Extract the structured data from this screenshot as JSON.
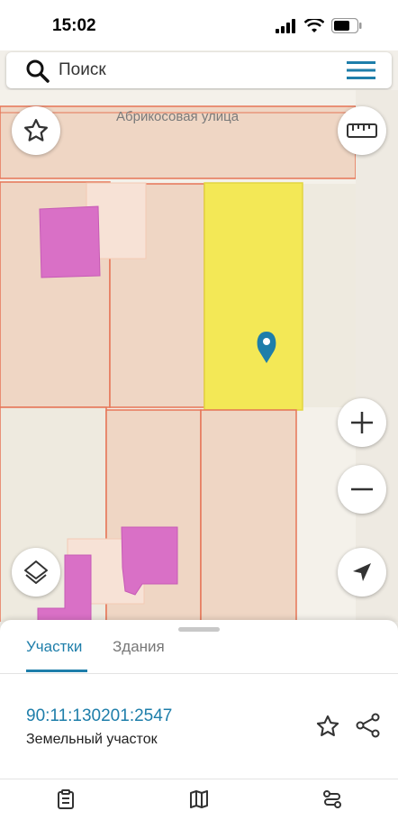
{
  "status": {
    "time": "15:02"
  },
  "search": {
    "placeholder": "Поиск"
  },
  "map": {
    "street_label": "Абрикосовая улица"
  },
  "colors": {
    "accent": "#1e7eaa",
    "selected_parcel": "#f3e856",
    "building": "#d970c6",
    "parcel_border": "#e67556"
  },
  "icons": [
    "search-icon",
    "menu-icon",
    "star-icon",
    "ruler-icon",
    "plus-icon",
    "minus-icon",
    "layers-icon",
    "navigation-arrow-icon",
    "location-pin-icon",
    "share-icon",
    "clipboard-icon",
    "map-icon",
    "route-icon"
  ],
  "sheet": {
    "tabs": [
      {
        "label": "Участки"
      },
      {
        "label": "Здания"
      }
    ],
    "parcel": {
      "cadastral_number": "90:11:130201:2547",
      "type": "Земельный участок"
    }
  }
}
